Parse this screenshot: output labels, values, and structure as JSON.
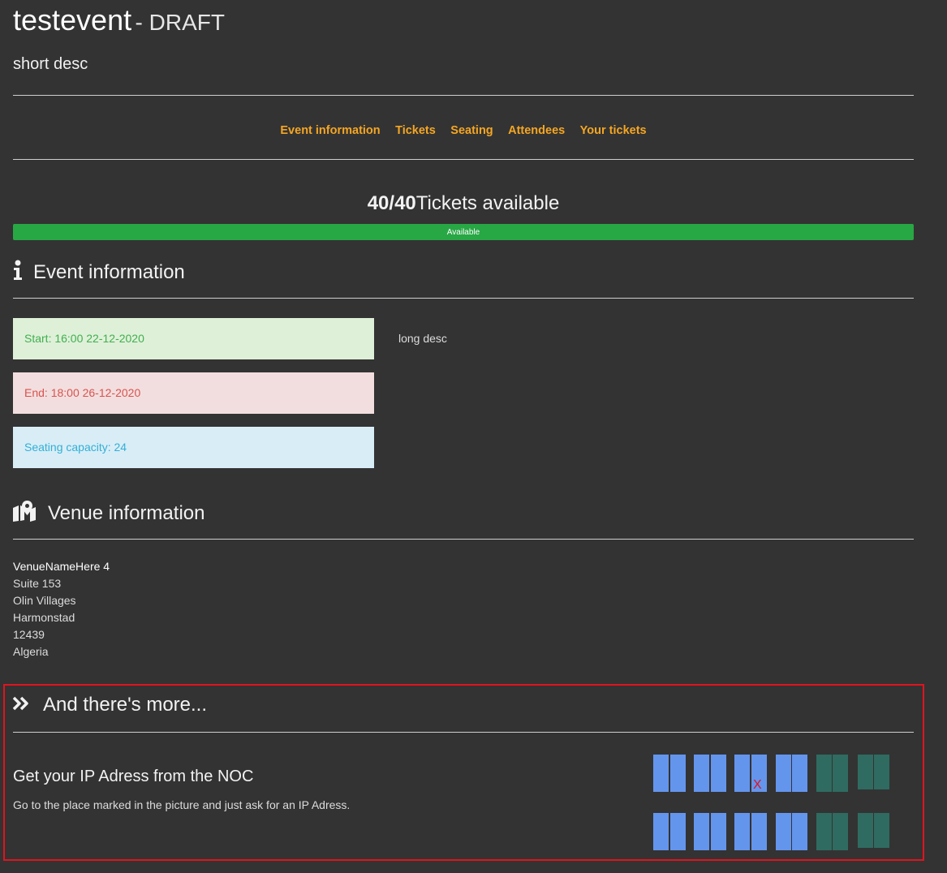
{
  "header": {
    "title": "testevent",
    "status": "- DRAFT",
    "short_desc": "short desc"
  },
  "nav": {
    "items": [
      "Event information",
      "Tickets",
      "Seating",
      "Attendees",
      "Your tickets"
    ]
  },
  "tickets": {
    "count": "40/40",
    "label": "Tickets available",
    "bar_label": "Available",
    "available_fraction": 1.0,
    "bar_color": "#28a745"
  },
  "event_info": {
    "heading": "Event information",
    "icon": "info-icon",
    "start": "Start: 16:00 22-12-2020",
    "end": "End: 18:00 26-12-2020",
    "capacity": "Seating capacity: 24",
    "long_desc": "long desc"
  },
  "venue": {
    "heading": "Venue information",
    "icon": "map-marker-icon",
    "lines": [
      "VenueNameHere 4",
      "Suite 153",
      "Olin Villages",
      "Harmonstad",
      "12439",
      "Algeria"
    ]
  },
  "more": {
    "heading": "And there's more...",
    "icon": "double-chevron-right-icon",
    "ip_title": "Get your IP Adress from the NOC",
    "ip_desc": "Go to the place marked in the picture and just ask for an IP Adress.",
    "marker": "X",
    "colors": {
      "seat_blue": "#6495ed",
      "seat_teal": "#2f6b60",
      "highlight": "#e0141e"
    }
  }
}
